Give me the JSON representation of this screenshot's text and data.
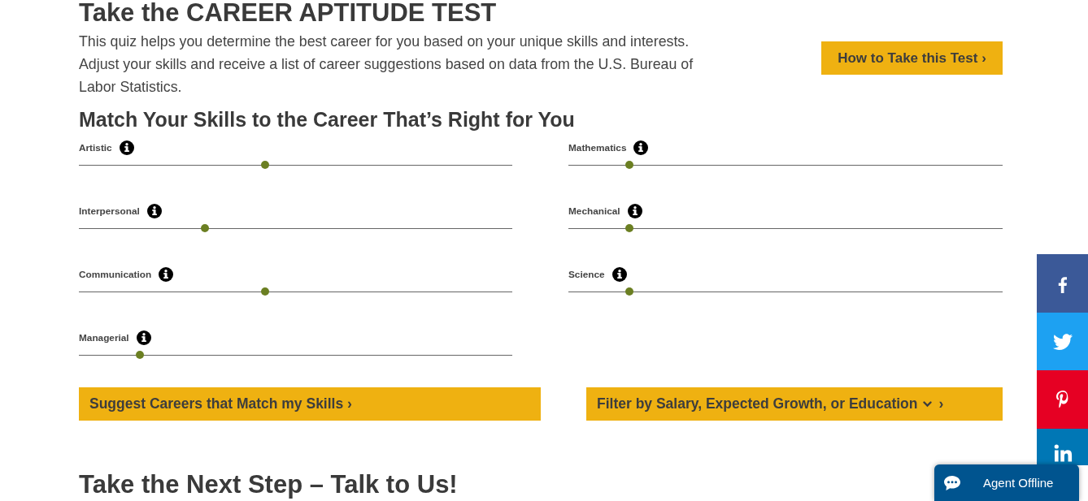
{
  "header": {
    "title": "Take the CAREER APTITUDE TEST",
    "intro": "This quiz helps you determine the best career for you based on your unique skills and interests. Adjust your skills and receive a list of career suggestions based on data from the U.S. Bureau of Labor Statistics.",
    "how_to_button": "How to Take this Test ›"
  },
  "skills": {
    "heading": "Match Your Skills to the Career That’s Right for You",
    "slider_columns": [
      {
        "sliders": [
          {
            "label": "Artistic",
            "level": 0.43
          },
          {
            "label": "Interpersonal",
            "level": 0.29
          },
          {
            "label": "Communication",
            "level": 0.43
          },
          {
            "label": "Managerial",
            "level": 0.14
          }
        ]
      },
      {
        "sliders": [
          {
            "label": "Mathematics",
            "level": 0.14
          },
          {
            "label": "Mechanical",
            "level": 0.14
          },
          {
            "label": "Science",
            "level": 0.14
          }
        ]
      }
    ]
  },
  "actions": {
    "suggest_button": "Suggest Careers that Match my Skills ›",
    "filter_button": {
      "label": "Filter by Salary, Expected Growth, or Education",
      "trailing": "›"
    }
  },
  "next_section": {
    "heading": "Take the Next Step – Talk to Us!"
  },
  "social_links": [
    {
      "kind": "facebook"
    },
    {
      "kind": "twitter"
    },
    {
      "kind": "pinterest"
    },
    {
      "kind": "linkedin"
    }
  ],
  "chat_widget": {
    "label": "Agent Offline"
  }
}
